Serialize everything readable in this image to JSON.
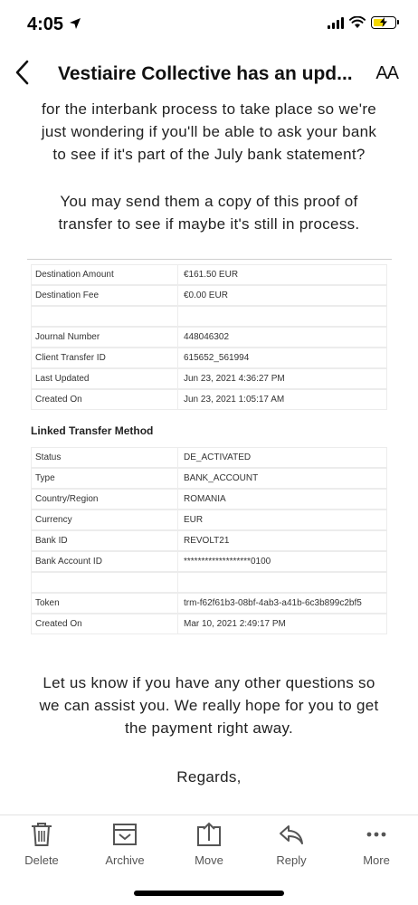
{
  "status_bar": {
    "time": "4:05",
    "icons": [
      "location-arrow-icon",
      "signal-icon",
      "wifi-icon",
      "battery-charging-icon"
    ],
    "battery_level": 0.55,
    "battery_color": "#f5d800"
  },
  "header": {
    "title": "Vestiaire Collective has an upd...",
    "text_size_label": "AA",
    "back_icon": "chevron-left-icon"
  },
  "message": {
    "para1": [
      "for the interbank process to take place so we're",
      "just wondering if you'll be able to ask your bank",
      "to see if it's part of the July bank statement?"
    ],
    "para2": [
      "You may send them a copy of this proof of",
      "transfer to see if maybe it's still in process."
    ],
    "transfer_rows": [
      {
        "label": "Destination Amount",
        "value": "€161.50 EUR"
      },
      {
        "label": "Destination Fee",
        "value": "€0.00 EUR"
      },
      {
        "label": "",
        "value": ""
      },
      {
        "label": "Journal Number",
        "value": "448046302"
      },
      {
        "label": "Client Transfer ID",
        "value": "615652_561994"
      },
      {
        "label": "Last Updated",
        "value": "Jun 23, 2021 4:36:27 PM"
      },
      {
        "label": "Created On",
        "value": "Jun 23, 2021 1:05:17 AM"
      }
    ],
    "linked_title": "Linked Transfer Method",
    "linked_rows": [
      {
        "label": "Status",
        "value": "DE_ACTIVATED"
      },
      {
        "label": "Type",
        "value": "BANK_ACCOUNT"
      },
      {
        "label": "Country/Region",
        "value": "ROMANIA"
      },
      {
        "label": "Currency",
        "value": "EUR"
      },
      {
        "label": "Bank ID",
        "value": "REVOLT21"
      },
      {
        "label": "Bank Account ID",
        "value": "*******************0100"
      },
      {
        "label": "",
        "value": ""
      },
      {
        "label": "Token",
        "value": "trm-f62f61b3-08bf-4ab3-a41b-6c3b899c2bf5"
      },
      {
        "label": "Created On",
        "value": "Mar 10, 2021 2:49:17 PM"
      }
    ],
    "para3": [
      "Let us know if you have any other questions so",
      "we can assist you. We really hope for you to get",
      "the payment right away."
    ],
    "regards": "Regards,"
  },
  "toolbar": {
    "delete": "Delete",
    "archive": "Archive",
    "move": "Move",
    "reply": "Reply",
    "more": "More"
  }
}
